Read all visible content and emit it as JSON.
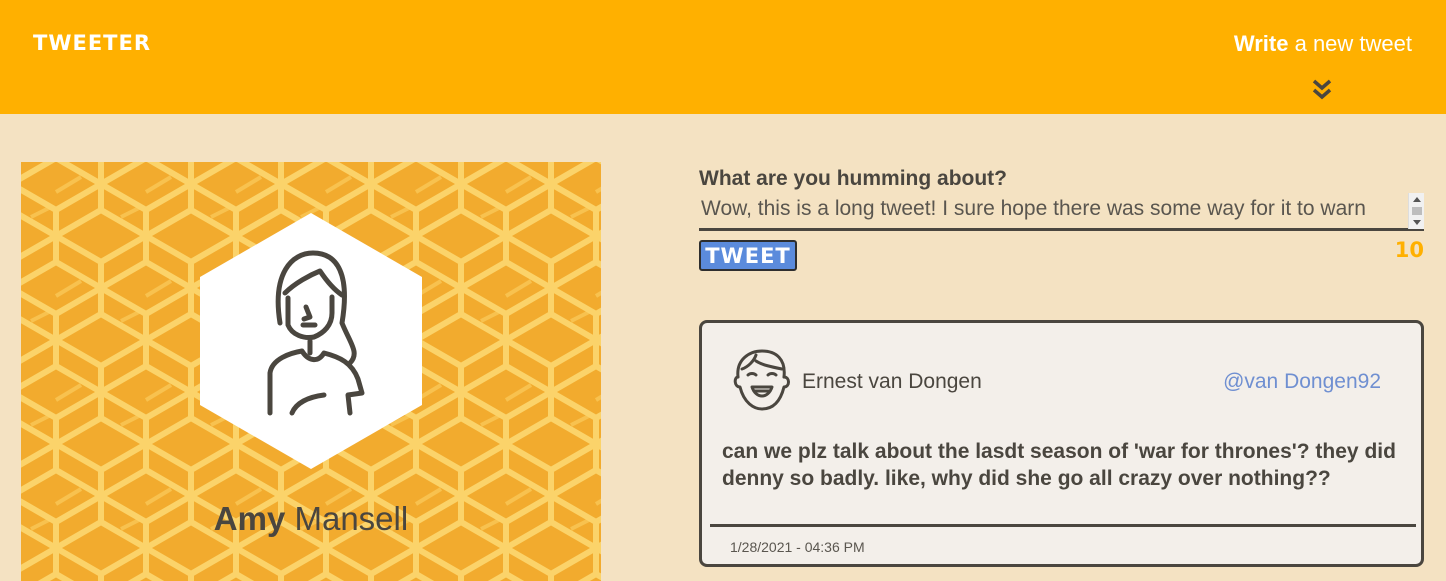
{
  "header": {
    "brand": "TWEETER",
    "write_bold": "Write",
    "write_rest": "a new tweet"
  },
  "profile": {
    "first_name": "Amy",
    "last_name": "Mansell"
  },
  "compose": {
    "label": "What are you humming about?",
    "text": "Wow, this is a long tweet! I sure hope there was some way for it to warn me when it goes over the amount of characters in this text",
    "button_label": "TWEET",
    "counter": "10"
  },
  "tweets": [
    {
      "name": "Ernest van Dongen",
      "handle": "@van Dongen92",
      "content": "can we plz talk about the lasdt season of 'war for thrones'? they did denny so badly. like, why did she go all crazy over nothing??",
      "date": "1/28/2021 - 04:36 PM"
    }
  ],
  "colors": {
    "header": "#ffb000",
    "background": "#f4e2c2",
    "text": "#4a463f",
    "button": "#5b8bdc",
    "handle": "#6f8fd1"
  }
}
